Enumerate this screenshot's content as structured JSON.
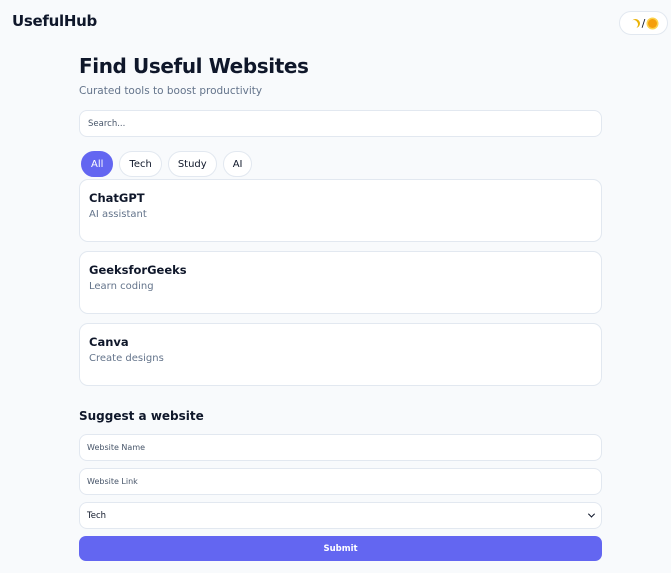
{
  "header": {
    "brand": "UsefulHub",
    "theme_toggle": {
      "separator": "/",
      "icons": [
        "moon-icon",
        "sun-icon"
      ]
    }
  },
  "hero": {
    "title": "Find Useful Websites",
    "subtitle": "Curated tools to boost productivity"
  },
  "search": {
    "placeholder": "Search...",
    "value": ""
  },
  "filters": [
    {
      "label": "All",
      "active": true
    },
    {
      "label": "Tech",
      "active": false
    },
    {
      "label": "Study",
      "active": false
    },
    {
      "label": "AI",
      "active": false
    }
  ],
  "cards": [
    {
      "title": "ChatGPT",
      "desc": "AI assistant"
    },
    {
      "title": "GeeksforGeeks",
      "desc": "Learn coding"
    },
    {
      "title": "Canva",
      "desc": "Create designs"
    }
  ],
  "suggest": {
    "title": "Suggest a website",
    "name_placeholder": "Website Name",
    "link_placeholder": "Website Link",
    "category_selected": "Tech",
    "submit_label": "Submit"
  },
  "colors": {
    "accent": "#6366f1",
    "background": "#f8fafc",
    "border": "#e2e8f0",
    "text": "#0f172a",
    "muted": "#64748b"
  }
}
